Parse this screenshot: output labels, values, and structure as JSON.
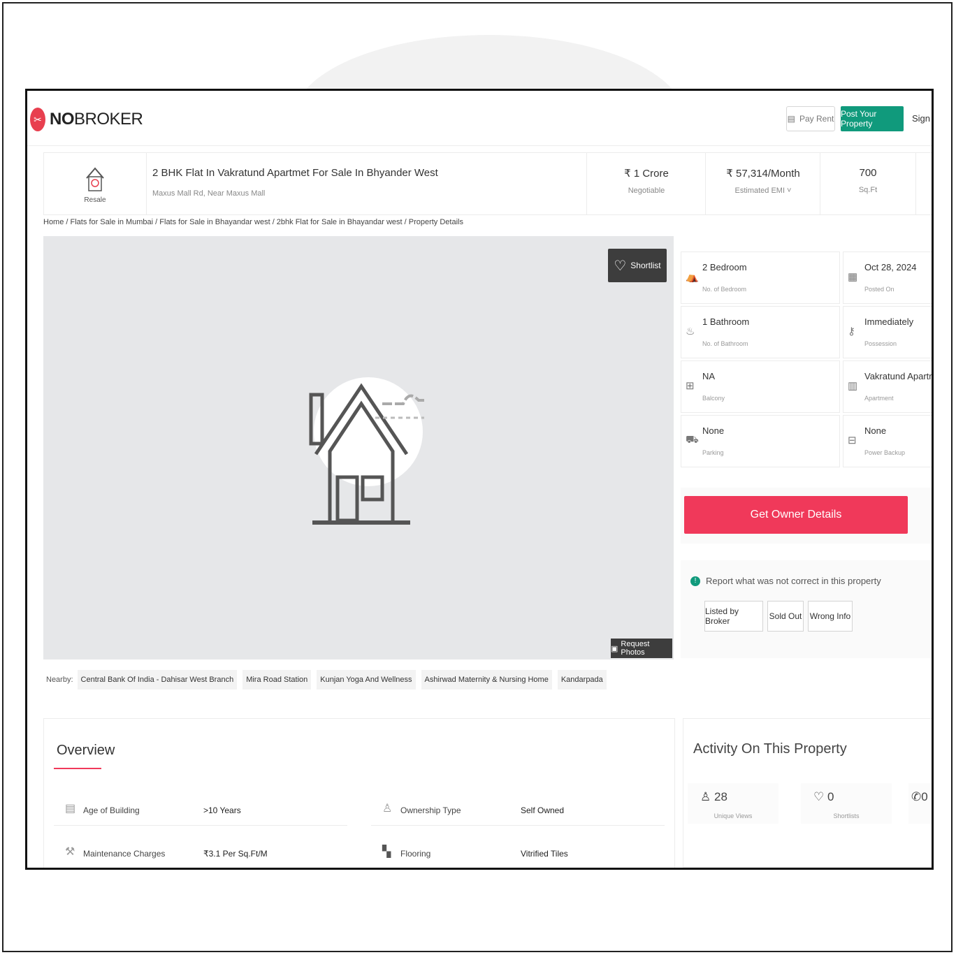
{
  "header": {
    "logo_no": "NO",
    "logo_broker": "BROKER",
    "pay_rent": "Pay Rent",
    "post_property": "Post Your Property",
    "sign_up": "Sign u"
  },
  "property": {
    "type_label": "Resale",
    "title": "2 BHK Flat In Vakratund Apartmet For Sale In Bhyander West",
    "address": "Maxus Mall Rd, Near Maxus Mall",
    "price": "₹ 1 Crore",
    "price_note": "Negotiable",
    "emi": "₹ 57,314/Month",
    "emi_note": "Estimated EMI ˅",
    "area": "700",
    "area_unit": "Sq.Ft"
  },
  "breadcrumb": "Home / Flats for Sale in Mumbai / Flats for Sale in Bhayandar west / 2bhk Flat for Sale in Bhayandar west / Property Details",
  "gallery": {
    "shortlist": "Shortlist",
    "request_photos": "Request Photos"
  },
  "nearby": {
    "label": "Nearby:",
    "places": [
      "Central Bank Of India - Dahisar West Branch",
      "Mira Road Station",
      "Kunjan Yoga And Wellness",
      "Ashirwad Maternity & Nursing Home",
      "Kandarpada"
    ]
  },
  "details": [
    {
      "value": "2 Bedroom",
      "label": "No. of Bedroom",
      "icon": "bed-icon"
    },
    {
      "value": "Oct 28, 2024",
      "label": "Posted On",
      "icon": "calendar-icon"
    },
    {
      "value": "1 Bathroom",
      "label": "No. of Bathroom",
      "icon": "bath-icon"
    },
    {
      "value": "Immediately",
      "label": "Possession",
      "icon": "key-icon"
    },
    {
      "value": "NA",
      "label": "Balcony",
      "icon": "balcony-icon"
    },
    {
      "value": "Vakratund Apartmet",
      "label": "Apartment",
      "icon": "building-icon"
    },
    {
      "value": "None",
      "label": "Parking",
      "icon": "car-icon"
    },
    {
      "value": "None",
      "label": "Power Backup",
      "icon": "battery-icon"
    }
  ],
  "actions": {
    "get_owner": "Get Owner Details",
    "report_title": "Report what was not correct in this property",
    "report_buttons": [
      "Listed by Broker",
      "Sold Out",
      "Wrong Info"
    ]
  },
  "overview": {
    "title": "Overview",
    "rows": [
      {
        "key": "Age of Building",
        "value": ">10 Years",
        "icon": "building-age-icon"
      },
      {
        "key": "Ownership Type",
        "value": "Self Owned",
        "icon": "ownership-icon"
      },
      {
        "key": "Maintenance Charges",
        "value": "₹3.1 Per Sq.Ft/M",
        "icon": "tools-icon"
      },
      {
        "key": "Flooring",
        "value": "Vitrified Tiles",
        "icon": "tiles-icon"
      }
    ]
  },
  "activity": {
    "title": "Activity On This Property",
    "items": [
      {
        "value": "28",
        "label": "Unique Views",
        "icon": "person-icon"
      },
      {
        "value": "0",
        "label": "Shortlists",
        "icon": "heart-icon"
      },
      {
        "value": "0",
        "label": "",
        "icon": "phone-icon"
      }
    ]
  },
  "colors": {
    "brand_red": "#f0395a",
    "brand_green": "#109a7c"
  }
}
